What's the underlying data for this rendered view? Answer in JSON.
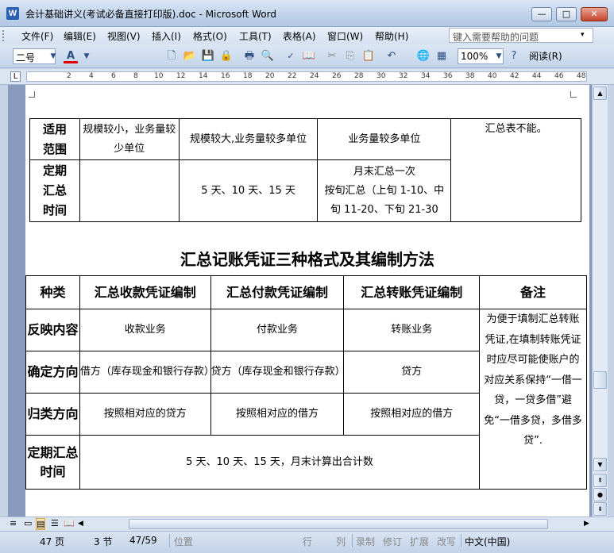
{
  "window": {
    "title": "会计基础讲义(考试必备直接打印版).doc - Microsoft Word",
    "app_icon": "W",
    "buttons": {
      "minimize": "—",
      "maximize": "□",
      "close": "✕"
    }
  },
  "menu": {
    "items": [
      "文件(F)",
      "编辑(E)",
      "视图(V)",
      "插入(I)",
      "格式(O)",
      "工具(T)",
      "表格(A)",
      "窗口(W)",
      "帮助(H)"
    ],
    "help_placeholder": "键入需要帮助的问题",
    "dropdown": "▾"
  },
  "toolbar": {
    "font_size": "二号",
    "font_color_label": "A",
    "font_color_hex": "#e00000",
    "zoom": "100%",
    "reading_label": "阅读(R)",
    "icons": [
      "new-icon",
      "open-icon",
      "save-icon",
      "permission-icon",
      "print-icon",
      "print-preview-icon",
      "spelling-icon",
      "research-icon",
      "cut-icon",
      "copy-icon",
      "paste-icon",
      "undo-icon",
      "hyperlink-icon",
      "table-icon",
      "help-icon"
    ]
  },
  "ruler": {
    "tab_symbol": "L",
    "numbers": [
      "2",
      "4",
      "6",
      "8",
      "10",
      "12",
      "14",
      "16",
      "18",
      "20",
      "22",
      "24",
      "26",
      "28",
      "30",
      "32",
      "34",
      "36",
      "38",
      "40",
      "42",
      "44",
      "46",
      "48"
    ]
  },
  "table1": {
    "rows": [
      {
        "header": [
          "适用",
          "范围"
        ],
        "cells": [
          "规模较小，业务量较少单位",
          "规模较大,业务量较多单位",
          "业务量较多单位"
        ],
        "note": "汇总表不能。"
      },
      {
        "header": [
          "定期",
          "汇总",
          "时间"
        ],
        "cells": [
          "",
          "5 天、10 天、15 天",
          "月末汇总一次\n按旬汇总（上旬 1-10、中旬 11-20、下旬 21-30"
        ]
      }
    ]
  },
  "section_heading": "汇总记账凭证三种格式及其编制方法",
  "table2": {
    "headers": [
      "种类",
      "汇总收款凭证编制",
      "汇总付款凭证编制",
      "汇总转账凭证编制",
      "备注"
    ],
    "rows": [
      {
        "label": "反映内容",
        "cells": [
          "收款业务",
          "付款业务",
          "转账业务"
        ]
      },
      {
        "label": "确定方向",
        "cells": [
          "借方（库存现金和银行存款）",
          "贷方（库存现金和银行存款）",
          "贷方"
        ]
      },
      {
        "label": "归类方向",
        "cells": [
          "按照相对应的贷方",
          "按照相对应的借方",
          "按照相对应的借方"
        ]
      },
      {
        "label": "定期汇总时间",
        "merged": "5 天、10 天、15 天，月末计算出合计数"
      }
    ],
    "note": "为便于填制汇总转账凭证,在填制转账凭证时应尽可能使账户的对应关系保持“一借一贷，一贷多借”避免“一借多贷，多借多贷”."
  },
  "statusbar": {
    "page": "47 页",
    "section": "3 节",
    "page_of": "47/59",
    "position_label": "位置",
    "line_label": "行",
    "col_label": "列",
    "modes": [
      "录制",
      "修订",
      "扩展",
      "改写"
    ],
    "language": "中文(中国)"
  }
}
